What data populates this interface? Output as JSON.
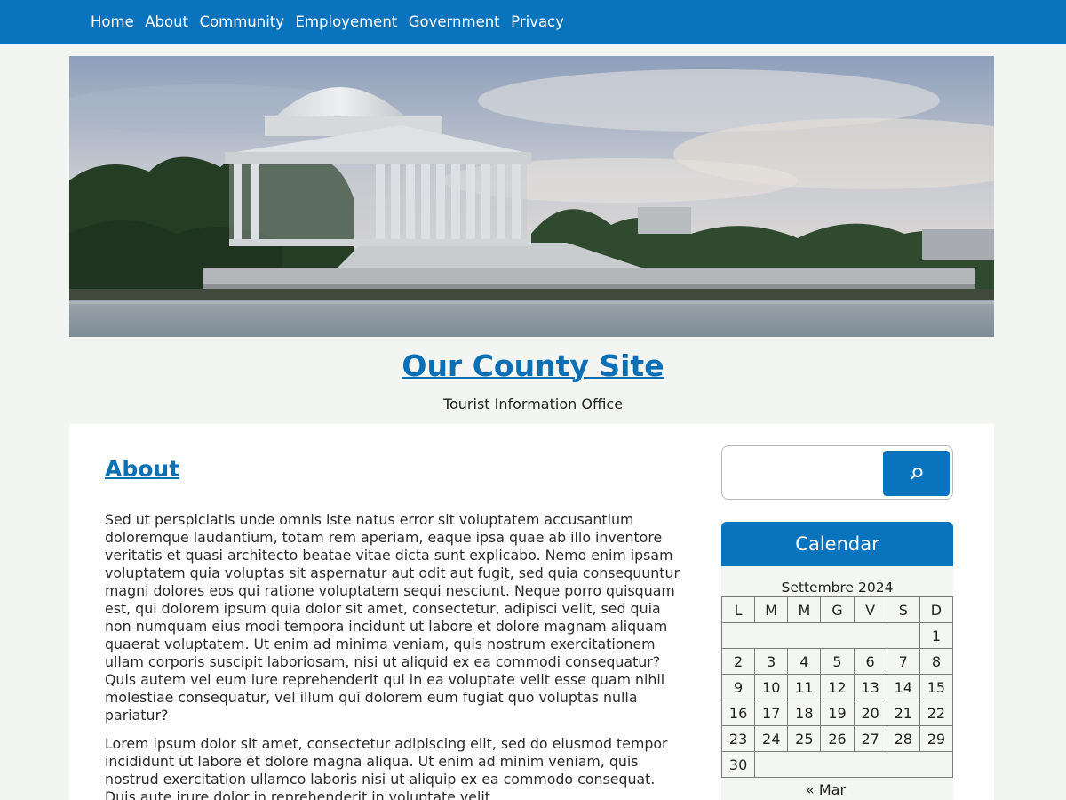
{
  "nav": {
    "items": [
      {
        "label": "Home"
      },
      {
        "label": "About"
      },
      {
        "label": "Community"
      },
      {
        "label": "Employement"
      },
      {
        "label": "Government"
      },
      {
        "label": "Privacy"
      }
    ]
  },
  "hero": {
    "icon": "memorial-photo"
  },
  "site": {
    "title": "Our County Site",
    "tagline": "Tourist Information Office"
  },
  "post": {
    "title": "About",
    "paragraphs": [
      "Sed ut perspiciatis unde omnis iste natus error sit voluptatem accusantium doloremque laudantium, totam rem aperiam, eaque ipsa quae ab illo inventore veritatis et quasi architecto beatae vitae dicta sunt explicabo. Nemo enim ipsam voluptatem quia voluptas sit aspernatur aut odit aut fugit, sed quia consequuntur magni dolores eos qui ratione voluptatem sequi nesciunt. Neque porro quisquam est, qui dolorem ipsum quia dolor sit amet, consectetur, adipisci velit, sed quia non numquam eius modi tempora incidunt ut labore et dolore magnam aliquam quaerat voluptatem. Ut enim ad minima veniam, quis nostrum exercitationem ullam corporis suscipit laboriosam, nisi ut aliquid ex ea commodi consequatur? Quis autem vel eum iure reprehenderit qui in ea voluptate velit esse quam nihil molestiae consequatur, vel illum qui dolorem eum fugiat quo voluptas nulla pariatur?",
      "Lorem ipsum dolor sit amet, consectetur adipiscing elit, sed do eiusmod tempor incididunt ut labore et dolore magna aliqua. Ut enim ad minim veniam, quis nostrud exercitation ullamco laboris nisi ut aliquip ex ea commodo consequat. Duis aute irure dolor in reprehenderit in voluptate velit"
    ]
  },
  "search": {
    "value": "",
    "button_icon": "search-icon"
  },
  "calendar": {
    "title": "Calendar",
    "caption": "Settembre 2024",
    "weekdays": [
      "L",
      "M",
      "M",
      "G",
      "V",
      "S",
      "D"
    ],
    "weeks": [
      [
        "",
        "",
        "",
        "",
        "",
        "",
        "1"
      ],
      [
        "2",
        "3",
        "4",
        "5",
        "6",
        "7",
        "8"
      ],
      [
        "9",
        "10",
        "11",
        "12",
        "13",
        "14",
        "15"
      ],
      [
        "16",
        "17",
        "18",
        "19",
        "20",
        "21",
        "22"
      ],
      [
        "23",
        "24",
        "25",
        "26",
        "27",
        "28",
        "29"
      ],
      [
        "30",
        "",
        "",
        "",
        "",
        "",
        ""
      ]
    ],
    "prev_link": "« Mar"
  },
  "colors": {
    "brand": "#0a73be",
    "link": "#0a6fb5",
    "page_bg": "#f3f5f2"
  }
}
